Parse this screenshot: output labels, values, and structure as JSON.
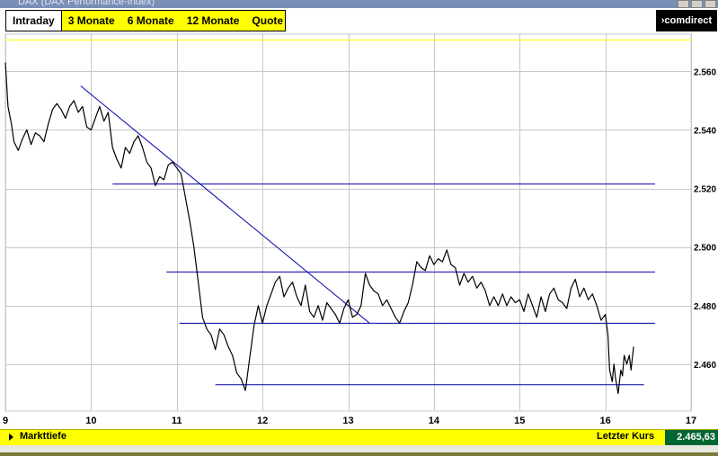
{
  "window": {
    "title": "DAX (DAX Performance-Index)"
  },
  "tabs": [
    {
      "label": "Intraday",
      "active": true
    },
    {
      "label": "3 Monate",
      "active": false
    },
    {
      "label": "6 Monate",
      "active": false
    },
    {
      "label": "12 Monate",
      "active": false
    },
    {
      "label": "Quote",
      "active": false
    }
  ],
  "logo": {
    "text": "›comdirect"
  },
  "footer": {
    "markttiefe": "Markttiefe",
    "letzter_kurs_label": "Letzter Kurs",
    "letzter_kurs_value": "2.465,63"
  },
  "colors": {
    "price_line": "#000000",
    "trend_line": "#0000aa",
    "grid": "#c8c8c8",
    "reference_line": "#ffff00",
    "accent": "#ffff00",
    "value_box": "#006633"
  },
  "chart_data": {
    "type": "line",
    "grid": true,
    "xlim": [
      9,
      17
    ],
    "ylim": [
      2444,
      2573
    ],
    "x_ticks": [
      {
        "value": 9,
        "label": "9"
      },
      {
        "value": 10,
        "label": "10"
      },
      {
        "value": 11,
        "label": "11"
      },
      {
        "value": 12,
        "label": "12"
      },
      {
        "value": 13,
        "label": "13"
      },
      {
        "value": 14,
        "label": "14"
      },
      {
        "value": 15,
        "label": "15"
      },
      {
        "value": 16,
        "label": "16"
      },
      {
        "value": 17,
        "label": "17"
      }
    ],
    "y_ticks": [
      {
        "value": 2460,
        "label": "2.460"
      },
      {
        "value": 2480,
        "label": "2.480"
      },
      {
        "value": 2500,
        "label": "2.500"
      },
      {
        "value": 2520,
        "label": "2.520"
      },
      {
        "value": 2540,
        "label": "2.540"
      },
      {
        "value": 2560,
        "label": "2.560"
      }
    ],
    "reference_line": 2571,
    "series": [
      {
        "points": [
          [
            9.0,
            2563
          ],
          [
            9.03,
            2548
          ],
          [
            9.07,
            2542
          ],
          [
            9.1,
            2536
          ],
          [
            9.15,
            2533
          ],
          [
            9.2,
            2537
          ],
          [
            9.25,
            2540
          ],
          [
            9.3,
            2535
          ],
          [
            9.35,
            2539
          ],
          [
            9.4,
            2538
          ],
          [
            9.45,
            2536
          ],
          [
            9.5,
            2542
          ],
          [
            9.55,
            2547
          ],
          [
            9.6,
            2549
          ],
          [
            9.65,
            2547
          ],
          [
            9.7,
            2544
          ],
          [
            9.75,
            2548
          ],
          [
            9.8,
            2550
          ],
          [
            9.85,
            2546
          ],
          [
            9.9,
            2548
          ],
          [
            9.95,
            2541
          ],
          [
            10.0,
            2540
          ],
          [
            10.05,
            2544
          ],
          [
            10.1,
            2548
          ],
          [
            10.15,
            2543
          ],
          [
            10.2,
            2546
          ],
          [
            10.25,
            2534
          ],
          [
            10.3,
            2530
          ],
          [
            10.35,
            2527
          ],
          [
            10.4,
            2534
          ],
          [
            10.45,
            2532
          ],
          [
            10.5,
            2536
          ],
          [
            10.55,
            2538
          ],
          [
            10.6,
            2534
          ],
          [
            10.65,
            2529
          ],
          [
            10.7,
            2527
          ],
          [
            10.75,
            2521
          ],
          [
            10.8,
            2524
          ],
          [
            10.85,
            2523
          ],
          [
            10.9,
            2528
          ],
          [
            10.95,
            2529
          ],
          [
            11.0,
            2527
          ],
          [
            11.05,
            2525
          ],
          [
            11.1,
            2517
          ],
          [
            11.15,
            2509
          ],
          [
            11.2,
            2500
          ],
          [
            11.25,
            2488
          ],
          [
            11.3,
            2476
          ],
          [
            11.35,
            2472
          ],
          [
            11.4,
            2470
          ],
          [
            11.45,
            2465
          ],
          [
            11.5,
            2472
          ],
          [
            11.55,
            2470
          ],
          [
            11.6,
            2466
          ],
          [
            11.65,
            2463
          ],
          [
            11.7,
            2457
          ],
          [
            11.75,
            2455
          ],
          [
            11.8,
            2451
          ],
          [
            11.85,
            2462
          ],
          [
            11.9,
            2473
          ],
          [
            11.95,
            2480
          ],
          [
            12.0,
            2474
          ],
          [
            12.05,
            2480
          ],
          [
            12.1,
            2484
          ],
          [
            12.15,
            2488
          ],
          [
            12.2,
            2490
          ],
          [
            12.25,
            2483
          ],
          [
            12.3,
            2486
          ],
          [
            12.35,
            2488
          ],
          [
            12.4,
            2483
          ],
          [
            12.45,
            2480
          ],
          [
            12.5,
            2487
          ],
          [
            12.55,
            2478
          ],
          [
            12.6,
            2476
          ],
          [
            12.65,
            2480
          ],
          [
            12.7,
            2475
          ],
          [
            12.75,
            2481
          ],
          [
            12.8,
            2479
          ],
          [
            12.85,
            2477
          ],
          [
            12.9,
            2474
          ],
          [
            12.95,
            2479
          ],
          [
            13.0,
            2482
          ],
          [
            13.05,
            2476
          ],
          [
            13.1,
            2477
          ],
          [
            13.15,
            2480
          ],
          [
            13.2,
            2491
          ],
          [
            13.25,
            2487
          ],
          [
            13.3,
            2485
          ],
          [
            13.35,
            2484
          ],
          [
            13.4,
            2480
          ],
          [
            13.45,
            2482
          ],
          [
            13.5,
            2479
          ],
          [
            13.55,
            2476
          ],
          [
            13.6,
            2474
          ],
          [
            13.65,
            2478
          ],
          [
            13.7,
            2481
          ],
          [
            13.75,
            2487
          ],
          [
            13.8,
            2495
          ],
          [
            13.85,
            2493
          ],
          [
            13.9,
            2492
          ],
          [
            13.95,
            2497
          ],
          [
            14.0,
            2494
          ],
          [
            14.05,
            2496
          ],
          [
            14.1,
            2495
          ],
          [
            14.15,
            2499
          ],
          [
            14.2,
            2494
          ],
          [
            14.25,
            2493
          ],
          [
            14.3,
            2487
          ],
          [
            14.35,
            2491
          ],
          [
            14.4,
            2488
          ],
          [
            14.45,
            2490
          ],
          [
            14.5,
            2486
          ],
          [
            14.55,
            2488
          ],
          [
            14.6,
            2485
          ],
          [
            14.65,
            2480
          ],
          [
            14.7,
            2483
          ],
          [
            14.75,
            2480
          ],
          [
            14.8,
            2484
          ],
          [
            14.85,
            2480
          ],
          [
            14.9,
            2483
          ],
          [
            14.95,
            2481
          ],
          [
            15.0,
            2482
          ],
          [
            15.05,
            2478
          ],
          [
            15.1,
            2484
          ],
          [
            15.15,
            2480
          ],
          [
            15.2,
            2476
          ],
          [
            15.25,
            2483
          ],
          [
            15.3,
            2478
          ],
          [
            15.35,
            2484
          ],
          [
            15.4,
            2486
          ],
          [
            15.45,
            2482
          ],
          [
            15.5,
            2481
          ],
          [
            15.55,
            2479
          ],
          [
            15.6,
            2486
          ],
          [
            15.65,
            2489
          ],
          [
            15.7,
            2483
          ],
          [
            15.75,
            2486
          ],
          [
            15.8,
            2482
          ],
          [
            15.85,
            2484
          ],
          [
            15.9,
            2480
          ],
          [
            15.95,
            2475
          ],
          [
            16.0,
            2477
          ],
          [
            16.03,
            2470
          ],
          [
            16.05,
            2458
          ],
          [
            16.08,
            2454
          ],
          [
            16.1,
            2460
          ],
          [
            16.12,
            2455
          ],
          [
            16.15,
            2450
          ],
          [
            16.18,
            2458
          ],
          [
            16.2,
            2456
          ],
          [
            16.22,
            2463
          ],
          [
            16.25,
            2460
          ],
          [
            16.28,
            2463
          ],
          [
            16.3,
            2458
          ],
          [
            16.33,
            2466
          ]
        ]
      }
    ],
    "trend_lines": [
      {
        "from": [
          9.88,
          2555
        ],
        "to": [
          13.25,
          2474
        ]
      },
      {
        "from": [
          10.25,
          2521.5
        ],
        "to": [
          16.58,
          2521.5
        ]
      },
      {
        "from": [
          10.88,
          2491.5
        ],
        "to": [
          16.58,
          2491.5
        ]
      },
      {
        "from": [
          11.03,
          2474
        ],
        "to": [
          16.58,
          2474
        ]
      },
      {
        "from": [
          11.45,
          2453
        ],
        "to": [
          16.45,
          2453
        ]
      }
    ]
  }
}
